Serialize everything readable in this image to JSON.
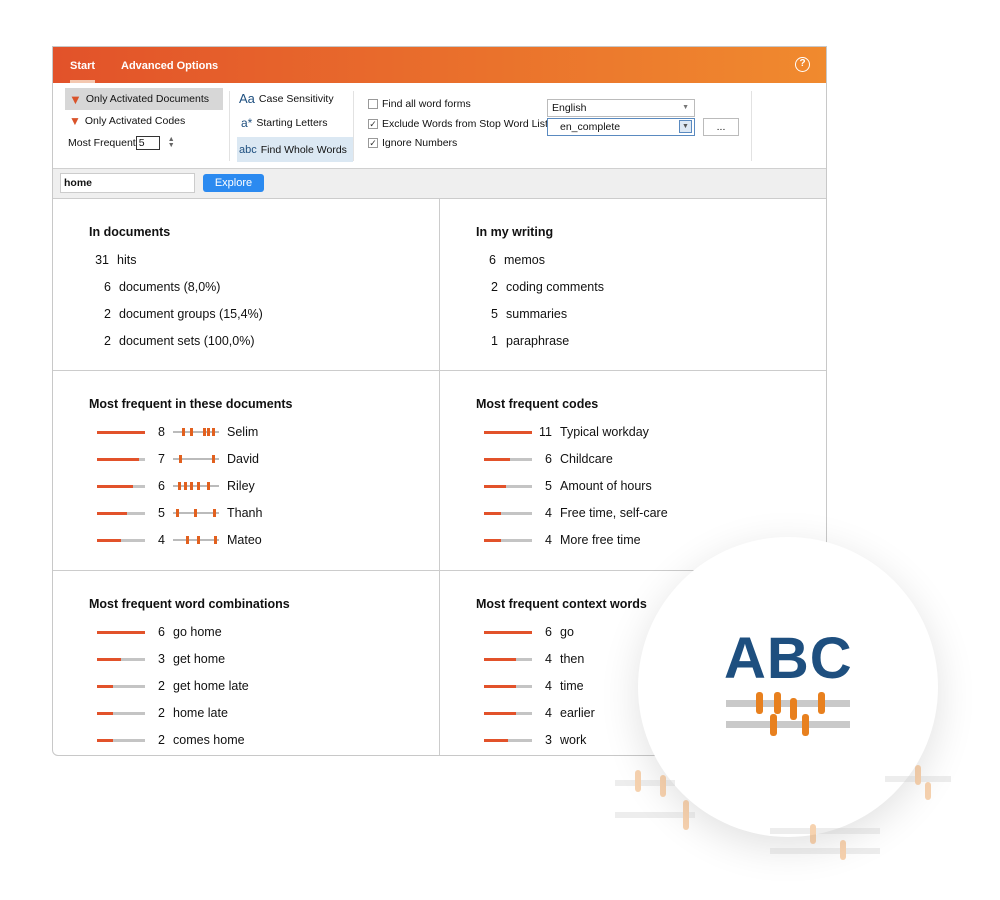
{
  "tabs": [
    {
      "label": "Start",
      "active": true
    },
    {
      "label": "Advanced Options",
      "active": false
    }
  ],
  "help_icon": "question-circle-icon",
  "toolbar": {
    "only_docs": "Only Activated Documents",
    "only_codes": "Only Activated Codes",
    "most_frequent_label": "Most Frequent",
    "most_frequent_value": "5",
    "case": "Case Sensitivity",
    "case_icon": "Aa",
    "starting": "Starting Letters",
    "starting_icon": "a*",
    "whole": "Find Whole Words",
    "whole_icon": "abc",
    "find_forms": {
      "label": "Find all word forms",
      "checked": false
    },
    "exclude": {
      "label": "Exclude Words from Stop Word List",
      "checked": true
    },
    "ignore": {
      "label": "Ignore Numbers",
      "checked": true
    },
    "language": "English",
    "stoplist": "en_complete",
    "more": "..."
  },
  "search": {
    "value": "home",
    "button": "Explore"
  },
  "colors": {
    "accent": "#e2522a",
    "blue": "#2b8af0",
    "abc": "#1e4f7f"
  },
  "in_documents": {
    "title": "In documents",
    "rows": [
      {
        "n": "31",
        "t": "hits"
      },
      {
        "n": "6",
        "t": "documents (8,0%)"
      },
      {
        "n": "2",
        "t": "document groups (15,4%)"
      },
      {
        "n": "2",
        "t": "document sets (100,0%)"
      }
    ]
  },
  "in_writing": {
    "title": "In my writing",
    "rows": [
      {
        "n": "6",
        "t": "memos"
      },
      {
        "n": "2",
        "t": "coding comments"
      },
      {
        "n": "5",
        "t": "summaries"
      },
      {
        "n": "1",
        "t": "paraphrase"
      }
    ]
  },
  "freq_docs": {
    "title": "Most frequent in these documents",
    "max": 8,
    "rows": [
      {
        "n": 8,
        "t": "Selim"
      },
      {
        "n": 7,
        "t": "David"
      },
      {
        "n": 6,
        "t": "Riley"
      },
      {
        "n": 5,
        "t": "Thanh"
      },
      {
        "n": 4,
        "t": "Mateo"
      }
    ]
  },
  "freq_codes": {
    "title": "Most frequent codes",
    "max": 11,
    "rows": [
      {
        "n": 11,
        "t": "Typical workday"
      },
      {
        "n": 6,
        "t": "Childcare"
      },
      {
        "n": 5,
        "t": "Amount of hours"
      },
      {
        "n": 4,
        "t": "Free time, self-care"
      },
      {
        "n": 4,
        "t": "More free time"
      }
    ]
  },
  "freq_combos": {
    "title": "Most frequent word combinations",
    "max": 6,
    "rows": [
      {
        "n": 6,
        "t": "go home"
      },
      {
        "n": 3,
        "t": "get home"
      },
      {
        "n": 2,
        "t": "get home late"
      },
      {
        "n": 2,
        "t": "home late"
      },
      {
        "n": 2,
        "t": "comes home"
      }
    ]
  },
  "freq_context": {
    "title": "Most frequent context words",
    "max": 6,
    "rows": [
      {
        "n": 6,
        "t": "go"
      },
      {
        "n": 4,
        "t": "then"
      },
      {
        "n": 4,
        "t": "time"
      },
      {
        "n": 4,
        "t": "earlier"
      },
      {
        "n": 3,
        "t": "work"
      }
    ]
  },
  "badge": {
    "text": "ABC"
  }
}
